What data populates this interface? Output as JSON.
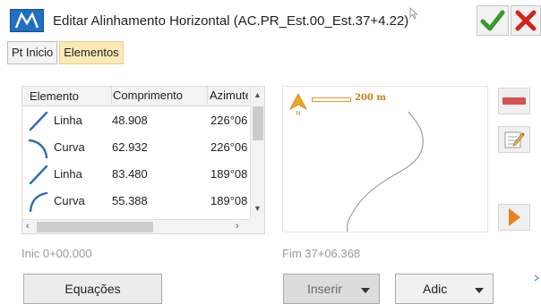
{
  "window": {
    "title": "Editar Alinhamento Horizontal  (AC.PR_Est.00_Est.37+4.22)",
    "app_icon": "m-logo-icon",
    "ok_icon": "checkmark-icon",
    "cancel_icon": "close-x-icon",
    "colors": {
      "app_icon": "#1f6fc5",
      "ok": "#3a9a2e",
      "cancel": "#d3231e"
    }
  },
  "tabs": [
    {
      "label": "Pt Inicio",
      "active": false
    },
    {
      "label": "Elementos",
      "active": true
    }
  ],
  "table": {
    "columns": [
      "Elemento",
      "Comprimento",
      "Azimute"
    ],
    "rows": [
      {
        "icon": "line-segment-icon",
        "element": "Linha",
        "length": "48.908",
        "azimuth": "226°06"
      },
      {
        "icon": "curve-arc-icon",
        "element": "Curva",
        "length": "62.932",
        "azimuth": "226°06"
      },
      {
        "icon": "line-segment-icon",
        "element": "Linha",
        "length": "83.480",
        "azimuth": "189°08"
      },
      {
        "icon": "curve-arc-icon",
        "element": "Curva",
        "length": "55.388",
        "azimuth": "189°08"
      }
    ]
  },
  "map": {
    "scale_label": "200 m",
    "north_label": "N",
    "colors": {
      "scale": "#e39a2c",
      "alignment": "#8c8c8c"
    }
  },
  "side_tools": {
    "delete_icon": "delete-element-icon",
    "edit_icon": "edit-note-icon",
    "expand_icon": "play-arrow-icon",
    "colors": {
      "delete": "#d95050",
      "expand": "#e8821e"
    }
  },
  "stations": {
    "start": "Inic 0+00.000",
    "end": "Fim 37+06.368"
  },
  "buttons": {
    "equations": "Equações",
    "insert": "Inserir",
    "add": "Adic"
  }
}
